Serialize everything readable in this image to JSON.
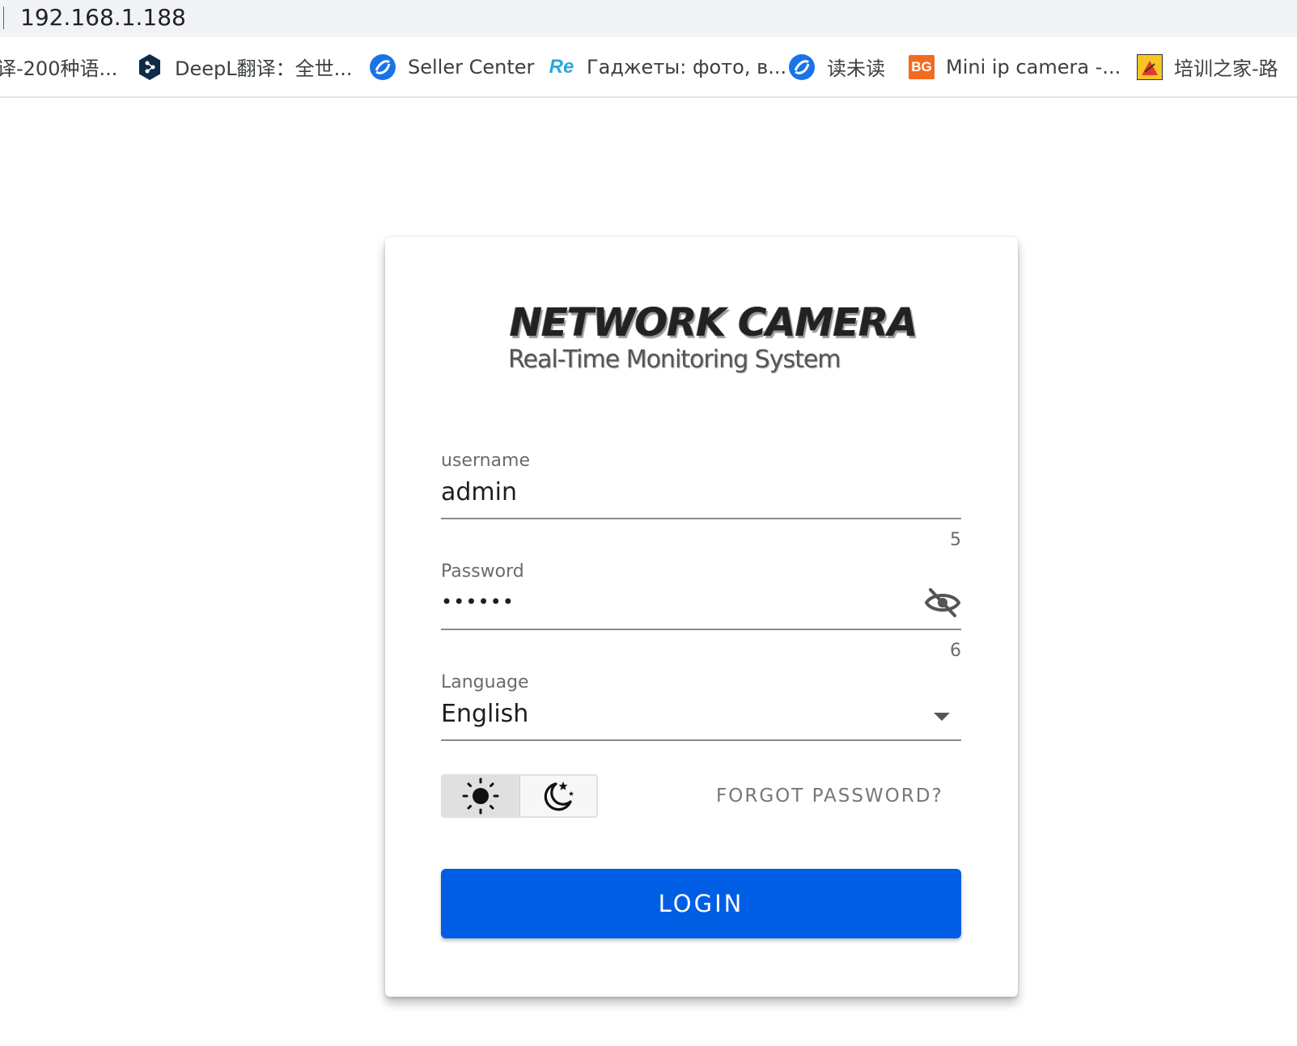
{
  "browser": {
    "url": "192.168.1.188",
    "bookmarks": [
      {
        "label": "译-200种语...",
        "icon": "none"
      },
      {
        "label": "DeepL翻译：全世...",
        "icon": "deepl-icon"
      },
      {
        "label": "Seller Center",
        "icon": "seller-center-icon"
      },
      {
        "label": "Гаджеты: фото, в...",
        "icon": "re-icon",
        "icon_text": "Re"
      },
      {
        "label": "读未读",
        "icon": "reading-icon"
      },
      {
        "label": "Mini ip camera -...",
        "icon": "bg-icon",
        "icon_text": "BG"
      },
      {
        "label": "培训之家-路",
        "icon": "training-icon"
      }
    ]
  },
  "login": {
    "logo_title": "NETWORK CAMERA",
    "logo_subtitle": "Real-Time Monitoring System",
    "username": {
      "label": "username",
      "value": "admin",
      "counter": "5"
    },
    "password": {
      "label": "Password",
      "value": "••••••",
      "counter": "6",
      "visibility_icon": "eye-off-icon"
    },
    "language": {
      "label": "Language",
      "value": "English",
      "dropdown_icon": "caret-down-icon"
    },
    "theme": {
      "light_icon": "sun-icon",
      "dark_icon": "moon-icon",
      "selected": "light"
    },
    "forgot_password": "FORGOT PASSWORD?",
    "login_button": "LOGIN"
  },
  "colors": {
    "primary": "#005ee5",
    "card_background": "#ffffff",
    "toggle_selected": "#e0e0e0"
  }
}
